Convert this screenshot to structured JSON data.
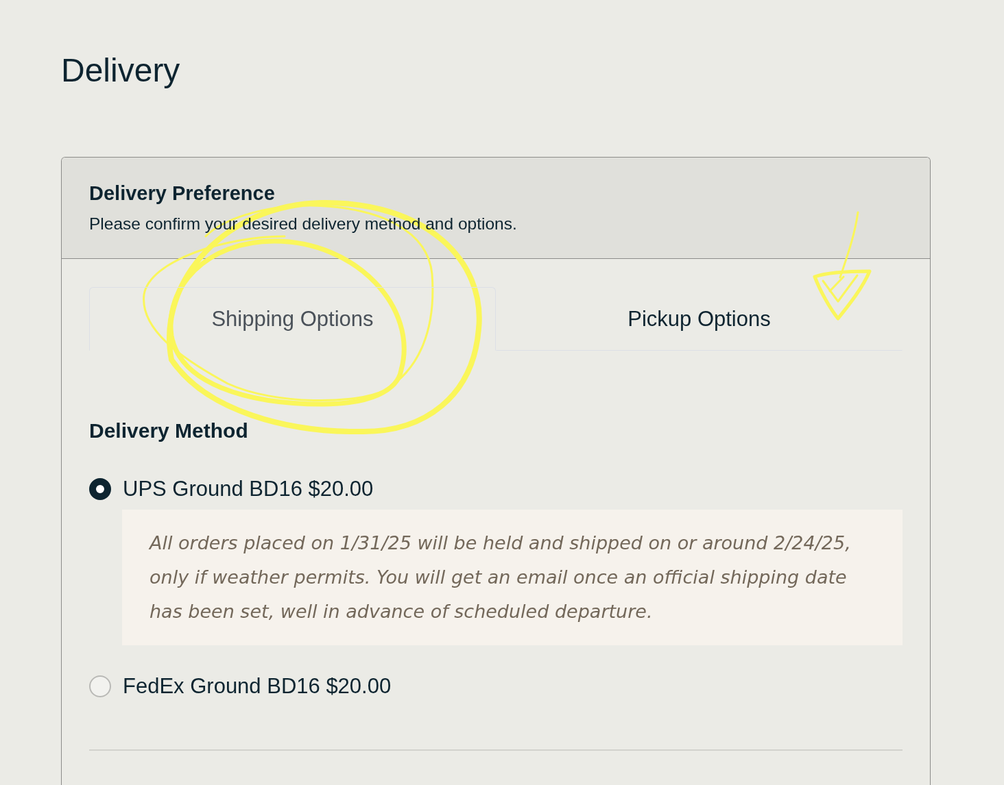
{
  "page": {
    "title": "Delivery"
  },
  "panel": {
    "title": "Delivery Preference",
    "subtitle": "Please confirm your desired delivery method and options."
  },
  "tabs": [
    {
      "label": "Shipping Options",
      "selected": true
    },
    {
      "label": "Pickup Options",
      "selected": false
    }
  ],
  "delivery_method": {
    "heading": "Delivery Method",
    "options": [
      {
        "label": "UPS Ground BD16 $20.00",
        "selected": true,
        "note": "All orders placed on 1/31/25 will be held and shipped on or around 2/24/25, only if weather permits. You will get an email once an official shipping date has been set, well in advance of scheduled departure."
      },
      {
        "label": "FedEx Ground BD16 $20.00",
        "selected": false
      }
    ]
  }
}
